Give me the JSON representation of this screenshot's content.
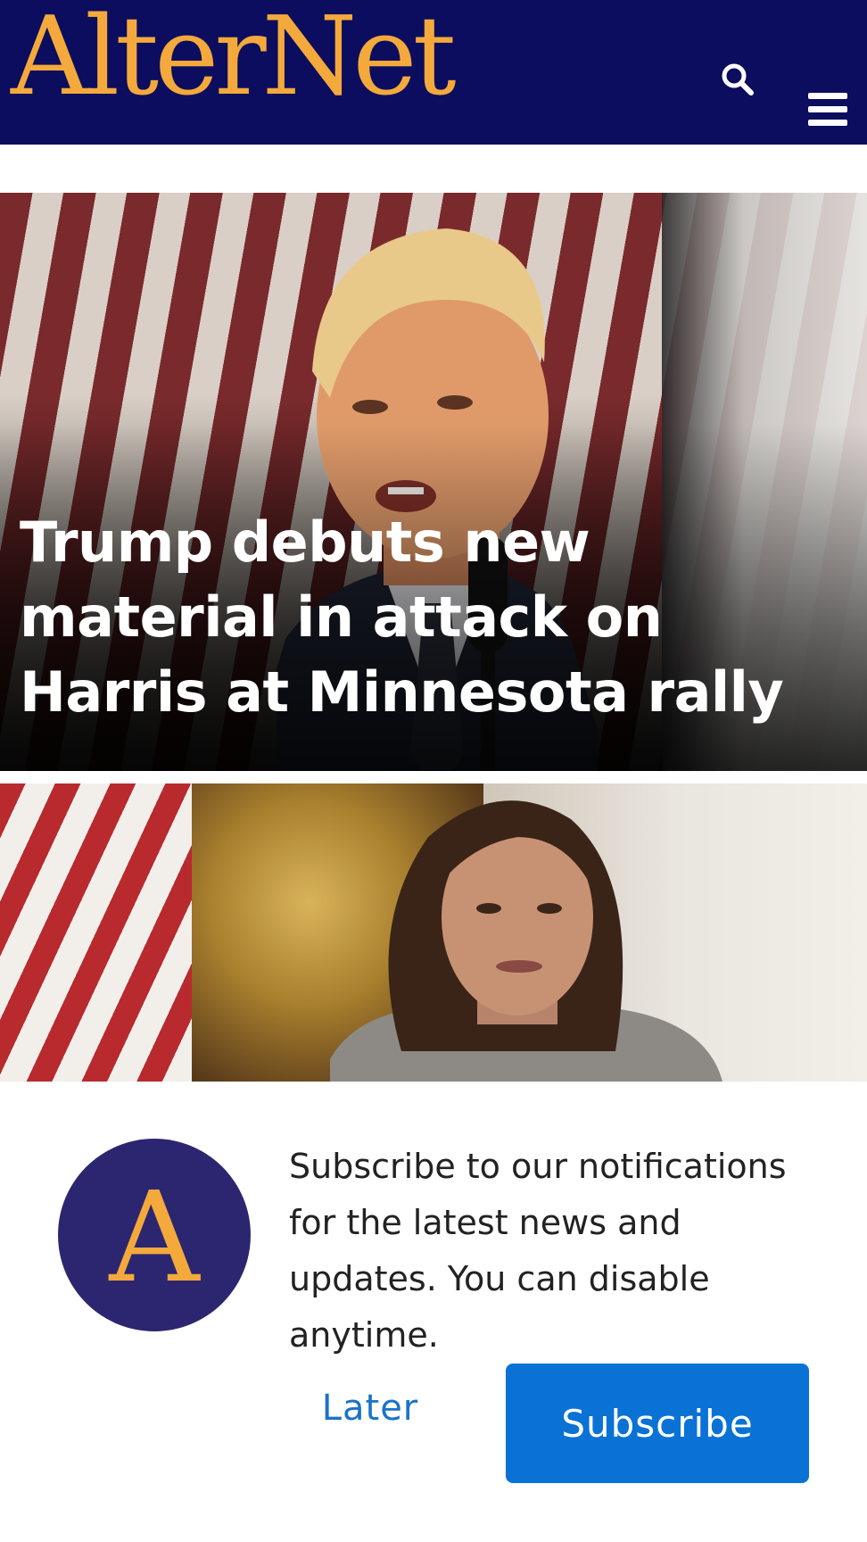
{
  "header": {
    "logo_text": "AlterNet",
    "bg_color": "#0c0d5e",
    "logo_color": "#f4a93c",
    "search_icon": "search-icon",
    "menu_icon": "hamburger-menu-icon"
  },
  "hero": {
    "title": "Trump debuts new material in attack on Harris at Minnesota rally"
  },
  "prompt": {
    "logo_letter": "A",
    "message": "Subscribe to our notifications for the latest news and updates. You can disable anytime.",
    "later_label": "Later",
    "subscribe_label": "Subscribe",
    "subscribe_color": "#0a72d4",
    "later_color": "#1a73c8"
  }
}
